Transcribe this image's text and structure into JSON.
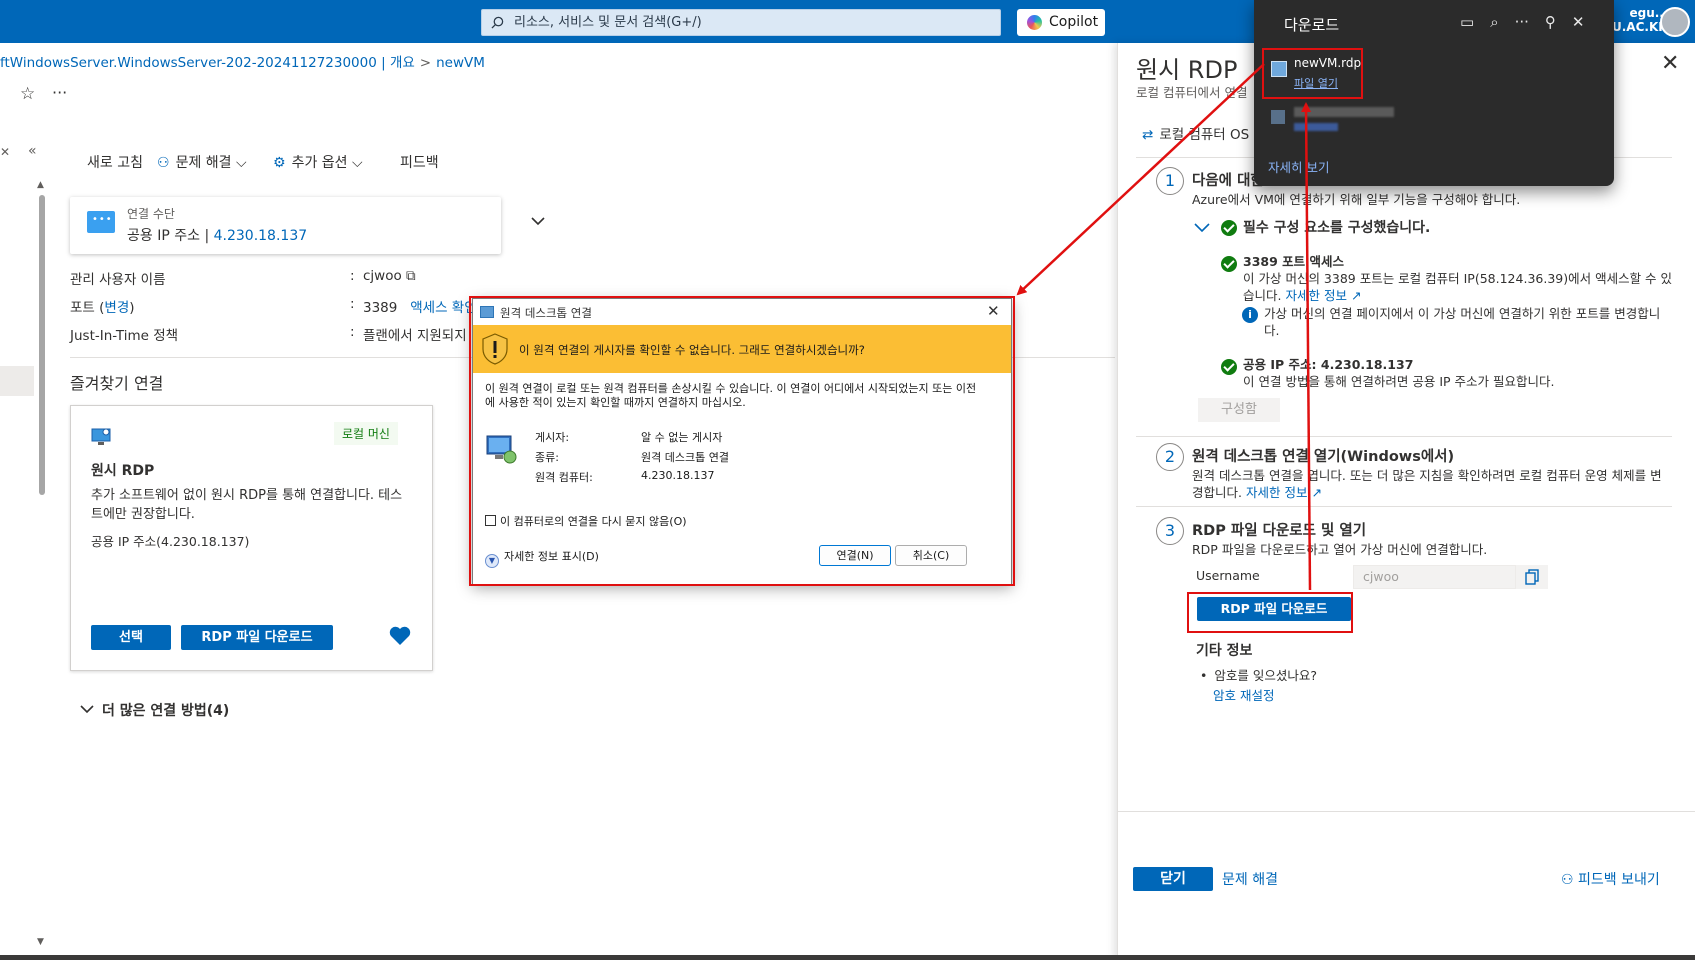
{
  "topbar": {
    "search_placeholder": "리소스, 서비스 및 문서 검색(G+/)",
    "copilot_label": "Copilot",
    "account_line1": "egu....",
    "account_line2": "U.AC.KR)"
  },
  "breadcrumb": {
    "item1": "ftWindowsServer.WindowsServer-202-20241127230000 | 개요",
    "sep": ">",
    "item2": "newVM"
  },
  "toolbar": {
    "refresh": "새로 고침",
    "troubleshoot": "문제 해결",
    "more_options": "추가 옵션",
    "feedback": "피드백"
  },
  "connection": {
    "label": "연결 수단",
    "value_prefix": "공용 IP 주소 |",
    "ip": "4.230.18.137"
  },
  "properties": {
    "admin_label": "관리 사용자 이름",
    "admin_value": "cjwoo",
    "port_label": "포트 (",
    "port_change": "변경",
    "port_label_end": ")",
    "port_value": "3389",
    "port_access": "액세스 확인",
    "jit_label": "Just-In-Time 정책",
    "jit_value": "플랜에서 지원되지",
    "colon": ":"
  },
  "favorites": {
    "title": "즐겨찾기 연결",
    "card": {
      "badge": "로컬 머신",
      "title": "원시 RDP",
      "desc": "추가 소프트웨어 없이 원시 RDP를 통해 연결합니다. 테스트에만 권장합니다.",
      "public_ip": "공용 IP 주소(4.230.18.137)",
      "select_btn": "선택",
      "download_btn": "RDP 파일 다운로드"
    }
  },
  "more_methods": "더 많은 연결 방법(4)",
  "pane": {
    "title": "원시 RDP",
    "subtitle": "로컬 컴퓨터에서 연결",
    "switch_os": "로컬 컴퓨터 OS",
    "step1": {
      "num": "1",
      "title": "다음에 대한",
      "desc": "Azure에서 VM에 연결하기 위해 일부 기능을 구성해야 합니다.",
      "prereq": "필수 구성 요소를 구성했습니다.",
      "port_title": "3389 포트 액세스",
      "port_desc": "이 가상 머신의 3389 포트는 로컬 컴퓨터 IP(58.124.36.39)에서 액세스할 수 있습니다.",
      "learn_more": "자세한 정보",
      "info_desc": "가상 머신의 연결 페이지에서 이 가상 머신에 연결하기 위한 포트를 변경합니다.",
      "ip_title": "공용 IP 주소: 4.230.18.137",
      "ip_desc": "이 연결 방법을 통해 연결하려면 공용 IP 주소가 필요합니다.",
      "configured_btn": "구성함"
    },
    "step2": {
      "num": "2",
      "title": "원격 데스크톱 연결 열기(Windows에서)",
      "desc": "원격 데스크톱 연결을 엽니다. 또는 더 많은 지침을 확인하려면 로컬 컴퓨터 운영 체제를 변경합니다.",
      "learn_more": "자세한 정보"
    },
    "step3": {
      "num": "3",
      "title": "RDP 파일 다운로드 및 열기",
      "desc": "RDP 파일을 다운로드하고 열어 가상 머신에 연결합니다.",
      "username_label": "Username",
      "username_value": "cjwoo",
      "download_btn": "RDP 파일 다운로드"
    },
    "other": {
      "title": "기타 정보",
      "question": "암호를 잊으셨나요?",
      "reset": "암호 재설정"
    },
    "footer": {
      "close": "닫기",
      "troubleshoot": "문제 해결",
      "feedback": "피드백 보내기"
    }
  },
  "downloads": {
    "title": "다운로드",
    "file_name": "newVM.rdp",
    "open_file": "파일 열기",
    "see_more": "자세히 보기"
  },
  "dialog": {
    "title": "원격 데스크톱 연결",
    "warning": "이 원격 연결의 게시자를 확인할 수 없습니다. 그래도 연결하시겠습니까?",
    "message": "이 원격 연결이 로컬 또는 원격 컴퓨터를 손상시킬 수 있습니다. 이 연결이 어디에서 시작되었는지 또는 이전에 사용한 적이 있는지 확인할 때까지 연결하지 마십시오.",
    "publisher_label": "게시자:",
    "publisher_value": "알 수 없는 게시자",
    "type_label": "종류:",
    "type_value": "원격 데스크톱 연결",
    "remote_label": "원격 컴퓨터:",
    "remote_value": "4.230.18.137",
    "checkbox": "이 컴퓨터로의 연결을 다시 묻지 않음(O)",
    "details": "자세한 정보 표시(D)",
    "connect_btn": "연결(N)",
    "cancel_btn": "취소(C)"
  },
  "colors": {
    "azure_blue": "#0067b8",
    "success_green": "#107c10",
    "warning_yellow": "#fbbe34",
    "annotation_red": "#e01010"
  }
}
